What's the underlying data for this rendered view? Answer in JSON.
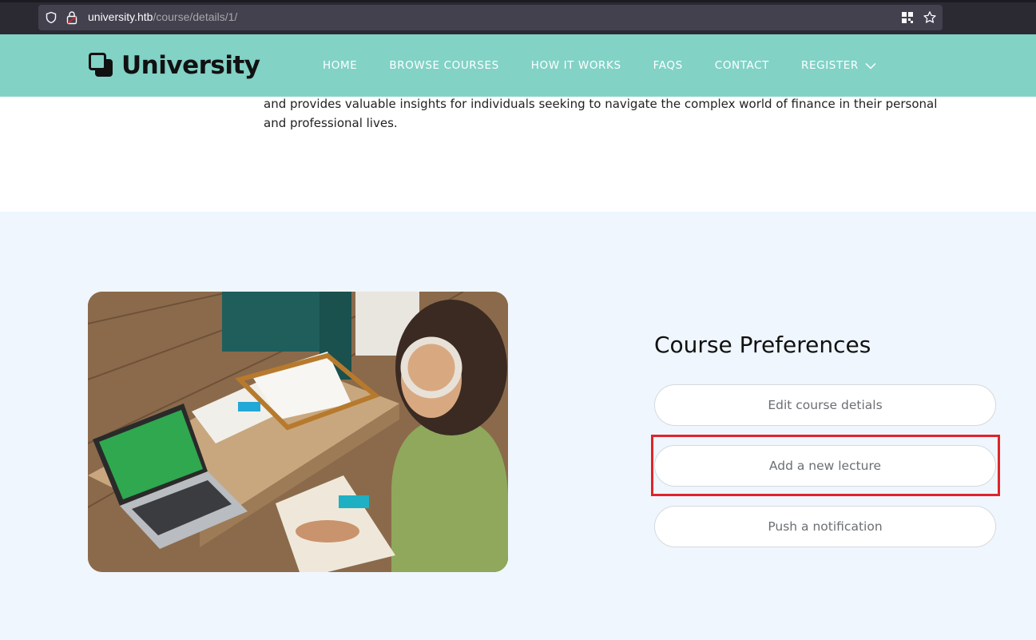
{
  "browser": {
    "url_host": "university.htb",
    "url_path": "/course/details/1/",
    "icons": [
      "shield-icon",
      "lock-icon",
      "qr-grid-icon",
      "bookmark-star-icon"
    ]
  },
  "header": {
    "logo_text": "University",
    "nav": [
      "HOME",
      "BROWSE COURSES",
      "HOW IT WORKS",
      "FAQS",
      "CONTACT",
      "REGISTER"
    ],
    "background": "#82d2c6"
  },
  "intro": {
    "text": "and provides valuable insights for individuals seeking to navigate the complex world of finance in their personal and professional lives."
  },
  "preferences": {
    "title": "Course Preferences",
    "buttons": [
      "Edit course detials",
      "Add a new lecture",
      "Push a notification"
    ],
    "highlight_color": "#e1232a",
    "section_background": "#eff6fd"
  }
}
